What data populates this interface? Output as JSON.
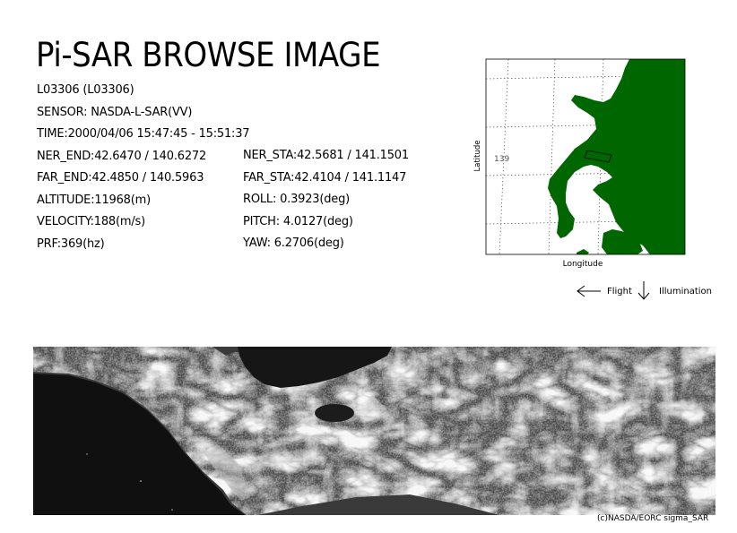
{
  "header": {
    "title": "Pi-SAR BROWSE IMAGE"
  },
  "info_left": [
    "L03306 (L03306)",
    "SENSOR: NASDA-L-SAR(VV)",
    "TIME:2000/04/06  15:47:45 - 15:51:37",
    "NER_END:42.6470 / 140.6272",
    "FAR_END:42.4850 / 140.5963",
    "ALTITUDE:11968(m)",
    "VELOCITY:188(m/s)",
    "PRF:369(hz)"
  ],
  "info_right": [
    "NER_STA:42.5681 / 141.1501",
    "FAR_STA:42.4104 / 141.1147",
    "ROLL: 0.3923(deg)",
    "PITCH:  4.0127(deg)",
    "YAW:   6.2706(deg)"
  ],
  "map": {
    "ylabel": "Latitude",
    "xlabel": "Longitude",
    "grid_label": "139",
    "land_color": "#006600"
  },
  "legend": {
    "flight_label": "Flight",
    "illumination_label": "Illumination"
  },
  "footer": {
    "copyright": "(c)NASDA/EORC sigma_SAR"
  }
}
